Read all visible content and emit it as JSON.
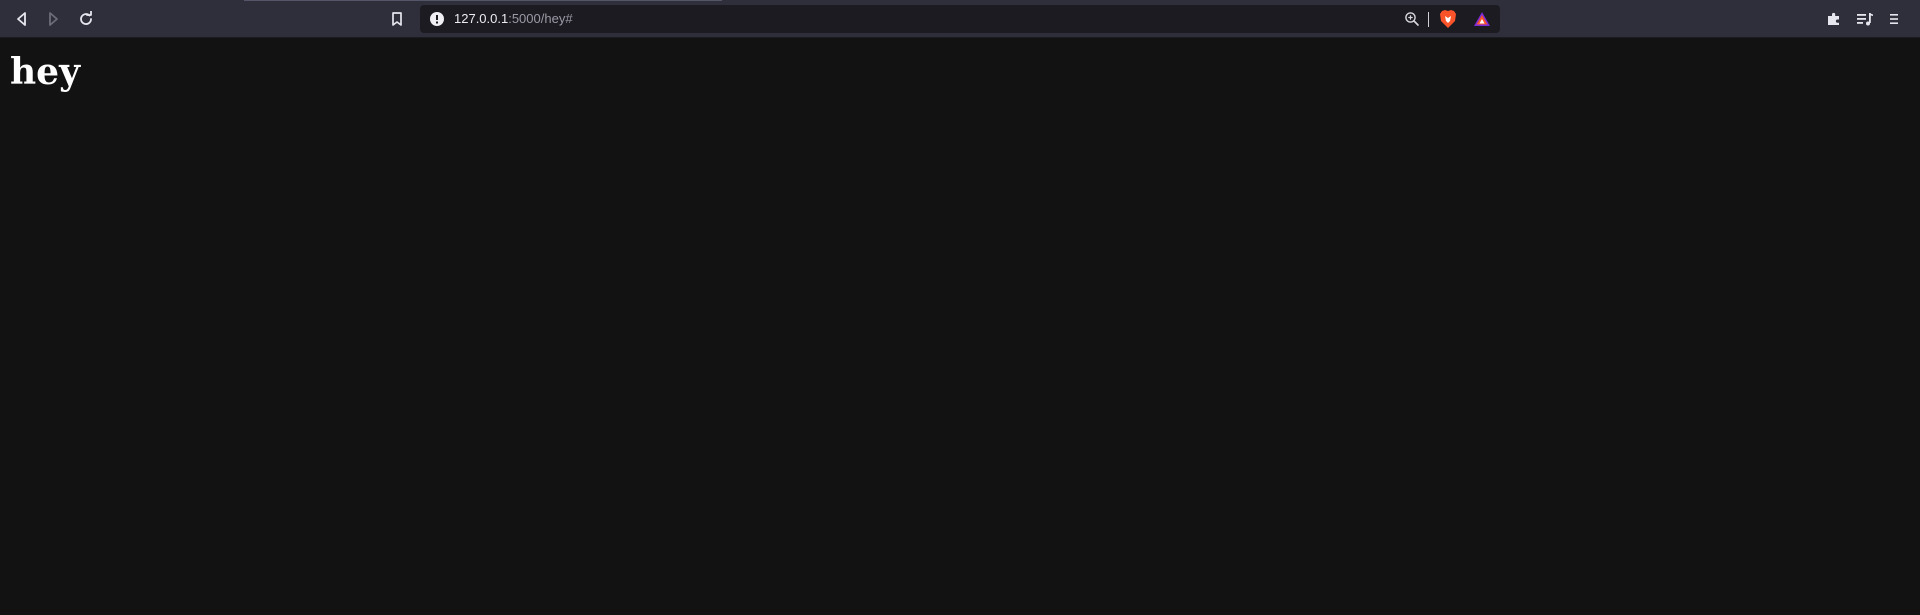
{
  "browser": {
    "address_bar": {
      "host": "127.0.0.1",
      "rest": ":5000/hey#"
    },
    "toolbar_icons": [
      "back-icon",
      "forward-icon",
      "reload-icon",
      "bookmark-icon",
      "site-info-icon",
      "zoom-icon",
      "brave-shields-icon",
      "brave-rewards-icon",
      "extensions-icon",
      "media-playlist-icon",
      "menu-icon"
    ],
    "colors": {
      "toolbar_bg": "#2f2f3b",
      "urlbar_bg": "#1c1b22",
      "page_bg": "#121212",
      "brave_orange": "#fb542b"
    }
  },
  "page": {
    "heading": "hey"
  }
}
